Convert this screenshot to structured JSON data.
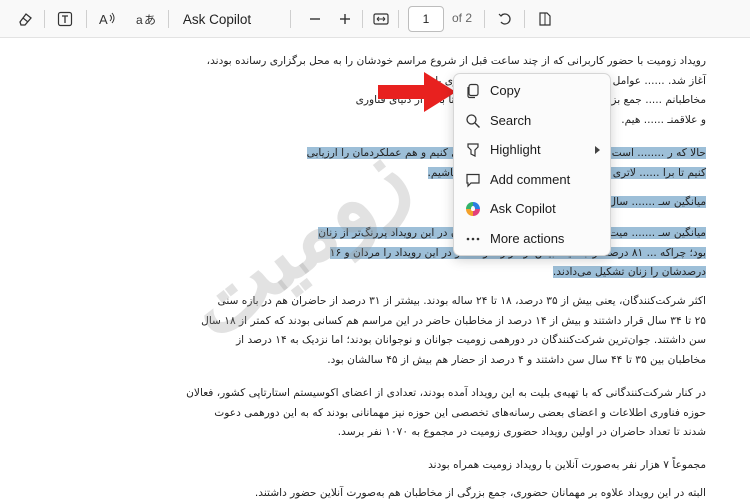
{
  "toolbar": {
    "ask_copilot": "Ask Copilot",
    "page_number": "1",
    "page_of": "of 2",
    "icons": [
      "eraser-icon",
      "text-box-icon",
      "read-aloud-icon",
      "translate-icon",
      "zoom-out-icon",
      "zoom-in-icon",
      "fit-width-icon",
      "rotate-icon",
      "page-view-icon"
    ]
  },
  "document": {
    "top_partial": "رویداد زومیت با حضور کاربرانی که از چند ساعت قبل از شروع مراسم خودشان را به محل برگزاری رسانده بودند،",
    "p1": [
      "رویداد زومیت با حضور کاربرانی که از چند ساعت قبل از شروع مراسم خودشان را به محل برگزاری رسانده بودند،",
      "آغاز شد. ...... عوامل زومیت بعد از سال‌ها معاشرت مجازی با",
      "مخاطبانم ..... جمع بزرگی از کاربران را از نزدیک ببینیم و تا باهم از دنیای فناوری",
      "و علاقمنـ ...... هیم."
    ],
    "p2": [
      "حالا که ر ........ است که هم آمارهای رویدادمان را بررسی کنیم و هم عملکردمان را ارزیابی",
      "کنیم تا برا ...... لاتری به دیدار شما بیاییم و میزبان بهتری باشیم."
    ],
    "p3": "میانگین سـ ....... سال بوده است",
    "p4": [
      "میانگین سـ ....... میت ۲۶.۱ سال بوده است. حضور مردان در این رویداد پررنگ‌تر از زنان",
      "بود؛ چراکه ... ۸۱ درصد از جمعیت بیش از هزار نفر حاضر در این رویداد را مردان و ۱۶",
      "درصدشان را زنان تشکیل می‌دادند."
    ],
    "p5": [
      "اکثر شرکت‌کنندگان، یعنی بیش از ۳۵ درصد، ۱۸ تا ۲۴ ساله بودند. بیشتر از ۳۱ درصد از حاضران هم در بازه سنی",
      "۲۵ تا ۳۴ سال قرار داشتند و بیش از ۱۴ درصد از مخاطبان حاضر در این مراسم هم کسانی بودند که کمتر از ۱۸ سال",
      "سن داشتند. جوان‌ترین شرکت‌کنندگان در دورهمی زومیت جوانان و نوجوانان بودند؛ اما نزدیک به ۱۴ درصد از",
      "مخاطبان بین ۳۵ تا ۴۴ سال سن داشتند و ۴ درصد از حضار هم بیش از ۴۵ سالشان بود."
    ],
    "p6": [
      "در کنار شرکت‌کنندگانی که با تهیه‌ی بلیت به این رویداد آمده بودند، تعدادی از اعضای اکوسیستم استارتاپی کشور، فعالان",
      "حوزه فناوری اطلاعات و اعضای بعضی رسانه‌های تخصصی این حوزه نیز مهمانانی بودند که به این دورهمی دعوت",
      "شدند تا تعداد حاضران در اولین رویداد حضوری زومیت در مجموع به ۱۰۷۰ نفر برسد."
    ],
    "p7": "مجموعاً ۷ هزار نفر به‌صورت آنلاین با رویداد زومیت همراه بودند",
    "p8": "البته در این رویداد علاوه بر مهمانان حضوری، جمع بزرگی از مخاطبان هم به‌صورت آنلاین حضور داشتند.",
    "watermark": "زومیت"
  },
  "context_menu": {
    "items": [
      {
        "label": "Copy",
        "icon": "copy-icon"
      },
      {
        "label": "Search",
        "icon": "search-icon"
      },
      {
        "label": "Highlight",
        "icon": "highlighter-icon"
      },
      {
        "label": "Add comment",
        "icon": "comment-icon"
      },
      {
        "label": "Ask Copilot",
        "icon": "copilot-icon"
      },
      {
        "label": "More actions",
        "icon": "more-icon"
      }
    ]
  },
  "colors": {
    "highlight": "#9dbfd8",
    "arrow": "#e8211f"
  }
}
